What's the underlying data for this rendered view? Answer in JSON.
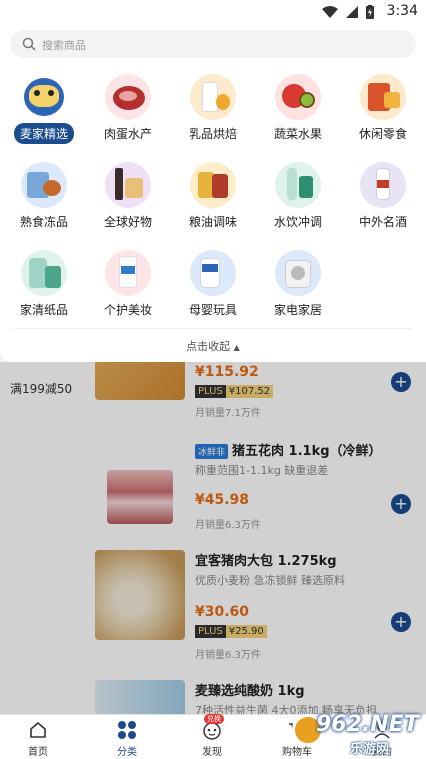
{
  "status_bar": {
    "time": "3:34"
  },
  "search": {
    "placeholder": "搜索商品"
  },
  "categories": [
    {
      "label": "麦家精选",
      "icon": "mascot-icon",
      "active": true
    },
    {
      "label": "肉蛋水产",
      "icon": "meat-icon"
    },
    {
      "label": "乳品烘焙",
      "icon": "milk-icon"
    },
    {
      "label": "蔬菜水果",
      "icon": "fruit-icon"
    },
    {
      "label": "休闲零食",
      "icon": "snack-icon"
    },
    {
      "label": "熟食冻品",
      "icon": "frozen-food-icon"
    },
    {
      "label": "全球好物",
      "icon": "global-goods-icon"
    },
    {
      "label": "粮油调味",
      "icon": "grain-oil-icon"
    },
    {
      "label": "水饮冲调",
      "icon": "beverage-icon"
    },
    {
      "label": "中外名酒",
      "icon": "liquor-icon"
    },
    {
      "label": "家清纸品",
      "icon": "cleaning-icon"
    },
    {
      "label": "个护美妆",
      "icon": "personal-care-icon"
    },
    {
      "label": "母婴玩具",
      "icon": "baby-icon"
    },
    {
      "label": "家电家居",
      "icon": "appliance-icon"
    }
  ],
  "collapse_label": "点击收起",
  "sidebar_promo": "满199减50",
  "products": [
    {
      "name": "",
      "price": "¥115.92",
      "plus_label": "PLUS",
      "plus_price": "¥107.52",
      "sales": "月销量7.1万件"
    },
    {
      "tag": "冰鲜非",
      "name": "猪五花肉 1.1kg（冷鲜）",
      "sub": "称重范围1-1.1kg 缺重退差",
      "price": "¥45.98",
      "sales": "月销量6.3万件"
    },
    {
      "name": "宜客猪肉大包 1.275kg",
      "sub": "优质小麦粉 急冻锁鲜 臻选原料",
      "price": "¥30.60",
      "plus_label": "PLUS",
      "plus_price": "¥25.90",
      "sales": "月销量6.3万件"
    },
    {
      "name": "麦臻选纯酸奶 1kg",
      "sub": "7种活性益生菌 4大0添加 畅享无负担"
    }
  ],
  "bottom_nav": [
    {
      "label": "首页",
      "icon": "home-icon"
    },
    {
      "label": "分类",
      "icon": "category-icon",
      "active": true
    },
    {
      "label": "发现",
      "icon": "discover-icon",
      "badge": "兑换"
    },
    {
      "label": "购物车",
      "icon": "cart-icon"
    },
    {
      "label": "我的",
      "icon": "profile-icon"
    }
  ],
  "watermark": {
    "text": "962.NET",
    "sub": "乐游网"
  },
  "colors": {
    "accent": "#1c4b8f",
    "price": "#e86c12",
    "plus_gold": "#f4d27a"
  }
}
